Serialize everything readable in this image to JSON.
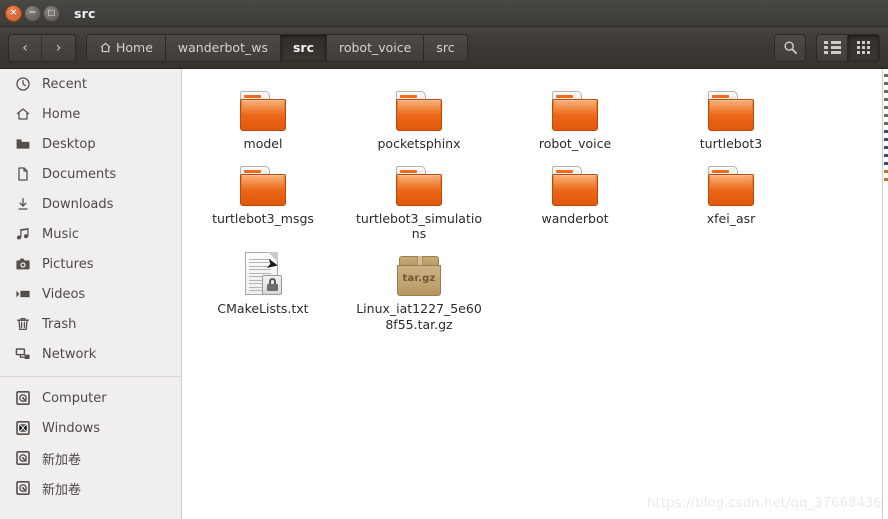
{
  "window": {
    "title": "src",
    "buttons": {
      "close": "×",
      "minimize": "−",
      "maximize": "□"
    }
  },
  "toolbar": {
    "back_label": "‹",
    "forward_label": "›",
    "search_label": "search-icon",
    "list_view_label": "list-view-icon",
    "grid_view_label": "grid-view-icon",
    "active_view": "grid",
    "breadcrumbs": [
      {
        "label": "Home",
        "icon": "home-icon",
        "active": false
      },
      {
        "label": "wanderbot_ws",
        "icon": "",
        "active": false
      },
      {
        "label": "src",
        "icon": "",
        "active": true
      },
      {
        "label": "robot_voice",
        "icon": "",
        "active": false
      },
      {
        "label": "src",
        "icon": "",
        "active": false
      }
    ]
  },
  "sidebar": {
    "groups": [
      {
        "items": [
          {
            "label": "Recent",
            "icon": "clock-icon"
          },
          {
            "label": "Home",
            "icon": "home-icon"
          },
          {
            "label": "Desktop",
            "icon": "folder-icon"
          },
          {
            "label": "Documents",
            "icon": "document-icon"
          },
          {
            "label": "Downloads",
            "icon": "download-icon"
          },
          {
            "label": "Music",
            "icon": "music-icon"
          },
          {
            "label": "Pictures",
            "icon": "camera-icon"
          },
          {
            "label": "Videos",
            "icon": "video-icon"
          },
          {
            "label": "Trash",
            "icon": "trash-icon"
          },
          {
            "label": "Network",
            "icon": "network-icon"
          }
        ]
      },
      {
        "items": [
          {
            "label": "Computer",
            "icon": "harddisk-icon"
          },
          {
            "label": "Windows",
            "icon": "windows-drive-icon"
          },
          {
            "label": "新加卷",
            "icon": "harddisk-icon"
          },
          {
            "label": "新加卷",
            "icon": "harddisk-icon"
          }
        ]
      }
    ]
  },
  "files": {
    "rows": [
      [
        {
          "name": "model",
          "type": "folder"
        },
        {
          "name": "pocketsphinx",
          "type": "folder"
        },
        {
          "name": "robot_voice",
          "type": "folder"
        },
        {
          "name": "turtlebot3",
          "type": "folder"
        }
      ],
      [
        {
          "name": "turtlebot3_msgs",
          "type": "folder"
        },
        {
          "name": "turtlebot3_simulations",
          "type": "folder"
        },
        {
          "name": "wanderbot",
          "type": "folder"
        },
        {
          "name": "xfei_asr",
          "type": "folder"
        }
      ],
      [
        {
          "name": "CMakeLists.txt",
          "type": "text-locked"
        },
        {
          "name": "Linux_iat1227_5e608f55.tar.gz",
          "type": "archive",
          "ext_label": "tar.gz"
        },
        {
          "name": "",
          "type": "empty"
        },
        {
          "name": "",
          "type": "empty"
        }
      ]
    ]
  },
  "watermark": {
    "text": "https://blog.csdn.net/qq_37668436"
  },
  "colors": {
    "titlebar": "#3d3b37",
    "toolbar": "#3b3834",
    "sidebar": "#f1efee",
    "content": "#ffffff",
    "folder_orange": "#ef7524",
    "archive_brown": "#c2a373"
  }
}
